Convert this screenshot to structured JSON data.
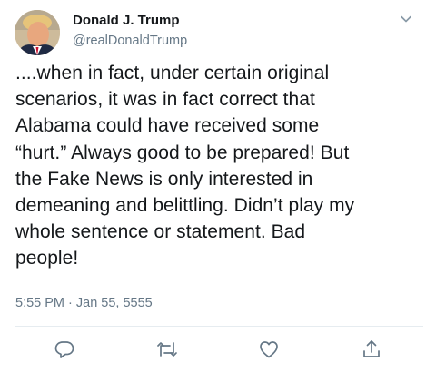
{
  "author": {
    "display_name": "Donald J. Trump",
    "handle": "@realDonaldTrump",
    "avatar_icon": "profile-photo"
  },
  "tweet": {
    "text": "....when in fact, under certain original\nscenarios, it was in fact correct that\nAlabama could have received some\n“hurt.” Always good to be prepared! But\nthe Fake News is only interested in\ndemeaning and belittling. Didn’t play my\nwhole sentence or statement. Bad\npeople!",
    "timestamp": "5:55 PM · Jan 55, 5555"
  },
  "actions": [
    {
      "icon": "reply-icon"
    },
    {
      "icon": "retweet-icon"
    },
    {
      "icon": "like-icon"
    },
    {
      "icon": "share-icon"
    }
  ],
  "colors": {
    "text": "#14171a",
    "secondary": "#657786",
    "divider": "#e6ecf0",
    "icon": "#657786"
  }
}
